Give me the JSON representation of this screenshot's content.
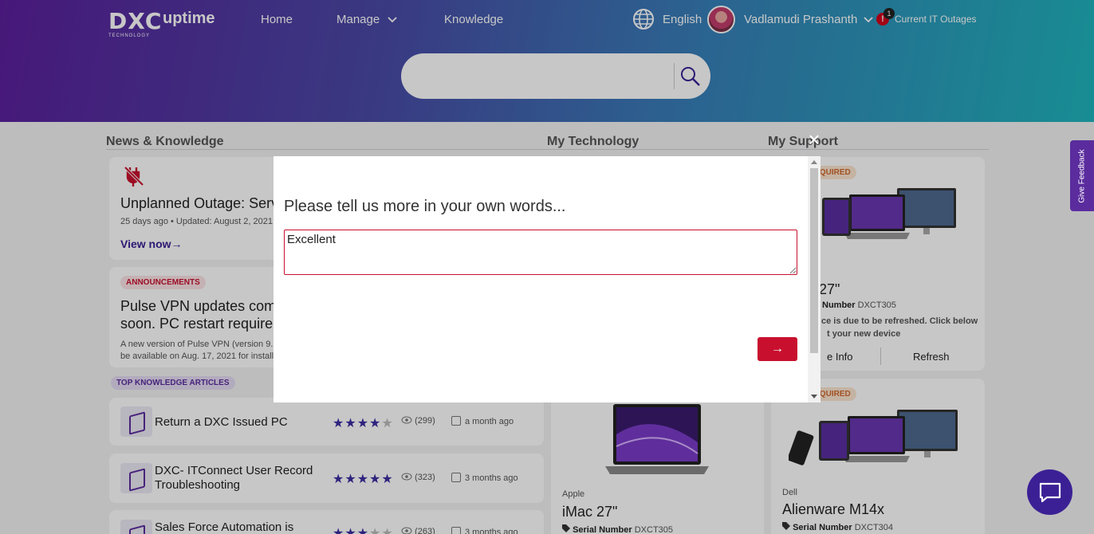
{
  "header": {
    "logo_text": "DXC",
    "logo_subtext": "TECHNOLOGY",
    "brand": "uptime",
    "nav": {
      "home": "Home",
      "manage": "Manage",
      "knowledge": "Knowledge"
    },
    "language": "English",
    "user_name": "Vadlamudi Prashanth",
    "outage_count": "1",
    "outages_label": "Current IT Outages",
    "search": {
      "placeholder": ""
    }
  },
  "sections": {
    "news": "News & Knowledge",
    "technology": "My Technology",
    "support": "My Support"
  },
  "news": {
    "outage": {
      "title": "Unplanned Outage: Serv",
      "meta": "25 days ago • Updated: August 2, 2021 a",
      "link": "View now→"
    },
    "announcement": {
      "badge": "ANNOUNCEMENTS",
      "title_line1": "Pulse VPN updates com",
      "title_line2": "soon. PC restart require",
      "body_line1": "A new version of Pulse VPN (version 9.1",
      "body_line2": "be available on Aug. 17, 2021 for install t"
    }
  },
  "top_articles": {
    "badge": "TOP KNOWLEDGE ARTICLES",
    "items": [
      {
        "title": "Return a DXC Issued PC",
        "rating": 4,
        "views": "(299)",
        "date": "a month ago"
      },
      {
        "title": "DXC- ITConnect User Record Troubleshooting",
        "rating": 5,
        "views": "(323)",
        "date": "3 months ago"
      },
      {
        "title": "Sales Force Automation is",
        "rating": 3,
        "views": "(263)",
        "date": "3 months ago"
      }
    ]
  },
  "technology": {
    "device": {
      "brand": "Apple",
      "name": "iMac 27\"",
      "serial_label": "Serial Number",
      "serial": "DXCT305"
    }
  },
  "support": {
    "card1": {
      "badge": "REQUIRED",
      "name": "27\"",
      "serial_label": "Number",
      "serial": "DXCT305",
      "note_line1": "ce is due to be refreshed. Click below",
      "note_line2": "t your new device",
      "more_info": "e Info",
      "refresh": "Refresh"
    },
    "card2": {
      "badge": "REQUIRED",
      "brand": "Dell",
      "name": "Alienware M14x",
      "serial_label": "Serial Number",
      "serial": "DXCT304"
    }
  },
  "feedback_tab": "Give Feedback",
  "modal": {
    "prompt": "Please tell us more in your own words...",
    "response": "Excellent",
    "submit": "→",
    "close": "×"
  },
  "colors": {
    "accent": "#5b2c9e",
    "danger": "#c8102e",
    "star": "#3b2ea0"
  }
}
